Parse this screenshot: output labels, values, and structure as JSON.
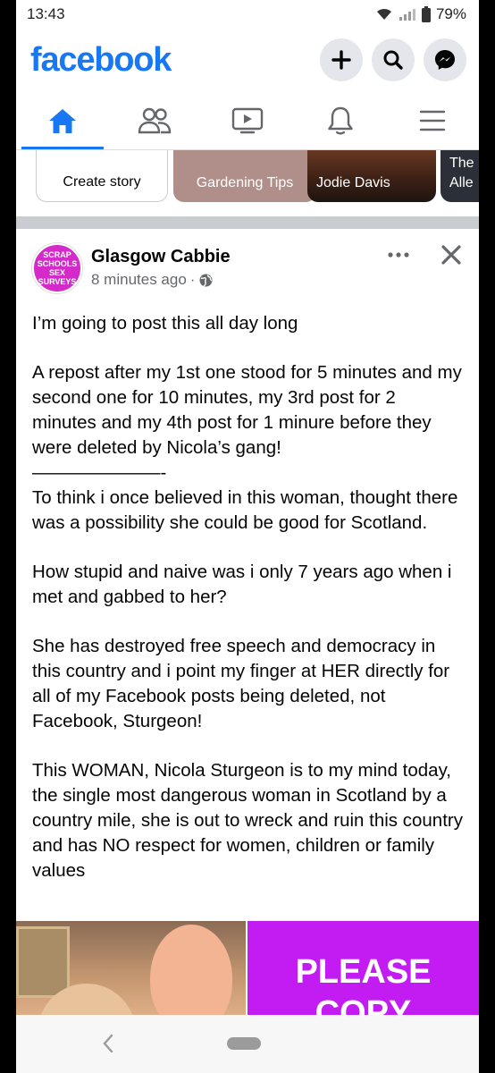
{
  "status_bar": {
    "time": "13:43",
    "battery": "79%"
  },
  "header": {
    "logo": "facebook"
  },
  "stories": [
    {
      "label": "Create story"
    },
    {
      "label": "Gardening Tips"
    },
    {
      "label": "Jodie Davis"
    },
    {
      "label_line1": "The",
      "label_line2": "Alle"
    }
  ],
  "post": {
    "avatar_lines": [
      "SCRAP",
      "SCHOOLS",
      "SEX",
      "SURVEYS"
    ],
    "author": "Glasgow Cabbie",
    "time": "8 minutes ago",
    "separator": "·",
    "paragraphs": {
      "p1": "I’m going to post this all day long",
      "p2": "A repost after my 1st one stood for 5 minutes and my second one for 10 minutes, my 3rd post for 2 minutes and my 4th post for 1 minure before they were deleted by Nicola’s gang!",
      "p2_dashes": "———————-",
      "p3": "To think i once believed in this woman, thought there was a possibility she could be good for Scotland.",
      "p4": "How stupid and naive was i only 7 years ago when i met and gabbed to her?",
      "p5": "She has destroyed free speech and democracy in this country and i point my finger at HER directly for all of my Facebook posts being deleted, not Facebook, Sturgeon!",
      "p6": "This WOMAN, Nicola Sturgeon is to my mind today, the single most dangerous woman in Scotland by a country mile, she is out to wreck and ruin this country and has NO respect for women, children or family values"
    },
    "image_text_line1": "PLEASE",
    "image_text_line2": "COPY"
  },
  "colors": {
    "brand": "#1877f2",
    "avatar": "#d42ac9",
    "please_bg": "#c21cf2"
  }
}
